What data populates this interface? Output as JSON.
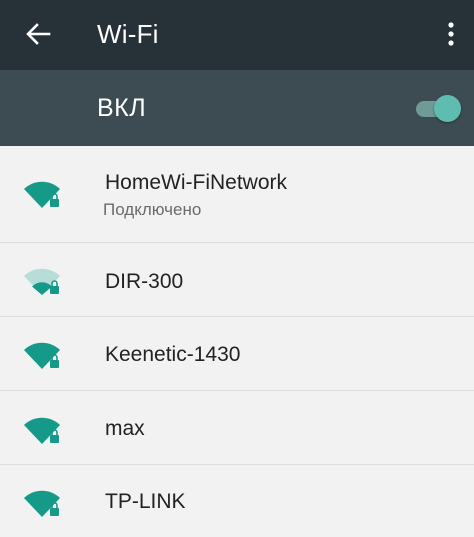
{
  "app_bar": {
    "title": "Wi-Fi",
    "back_icon": "arrow-back-icon",
    "menu_icon": "more-vert-icon"
  },
  "wifi_switch": {
    "label": "ВКЛ",
    "on": true
  },
  "networks": [
    {
      "name": "HomeWi-FiNetwork",
      "status": "Подключено",
      "secured": true,
      "signal": "full"
    },
    {
      "name": "DIR-300",
      "secured": true,
      "signal": "weak"
    },
    {
      "name": "Keenetic-1430",
      "secured": true,
      "signal": "full"
    },
    {
      "name": "max",
      "secured": true,
      "signal": "full"
    },
    {
      "name": "TP-LINK",
      "secured": true,
      "signal": "full"
    }
  ],
  "colors": {
    "app_bar": "#273238",
    "switch_bar": "#3d4b52",
    "accent": "#159a8a",
    "toggle_thumb": "#5fbcb0",
    "list_background": "#f2f2f2"
  }
}
